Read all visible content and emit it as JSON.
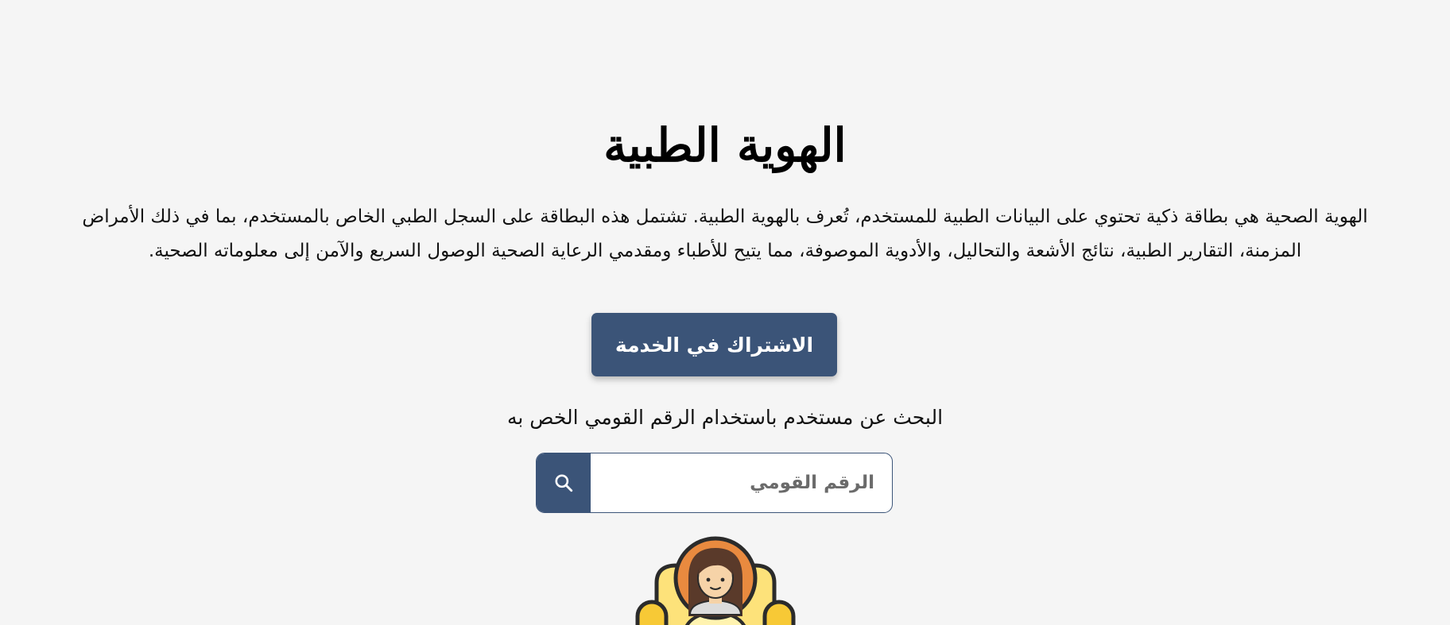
{
  "page": {
    "title": "الهوية الطبية",
    "description": "الهوية الصحية هي بطاقة ذكية تحتوي على البيانات الطبية للمستخدم، تُعرف بالهوية الطبية. تشتمل هذه البطاقة على السجل الطبي الخاص بالمستخدم، بما في ذلك الأمراض المزمنة، التقارير الطبية، نتائج الأشعة والتحاليل، والأدوية الموصوفة، مما يتيح للأطباء ومقدمي الرعاية الصحية الوصول السريع والآمن إلى معلوماته الصحية."
  },
  "subscribe": {
    "label": "الاشتراك في الخدمة"
  },
  "search": {
    "label": "البحث عن مستخدم باستخدام الرقم القومي الخص به",
    "placeholder": "الرقم القومي",
    "value": "",
    "icon": "search-icon"
  },
  "avatar": {
    "icon": "user-avatar-illustration"
  },
  "colors": {
    "primary": "#3b5478",
    "background": "#f5f5f5",
    "avatar_hair": "#5a3a2a",
    "avatar_circle": "#e98a3f",
    "avatar_chair": "#fde27a"
  }
}
